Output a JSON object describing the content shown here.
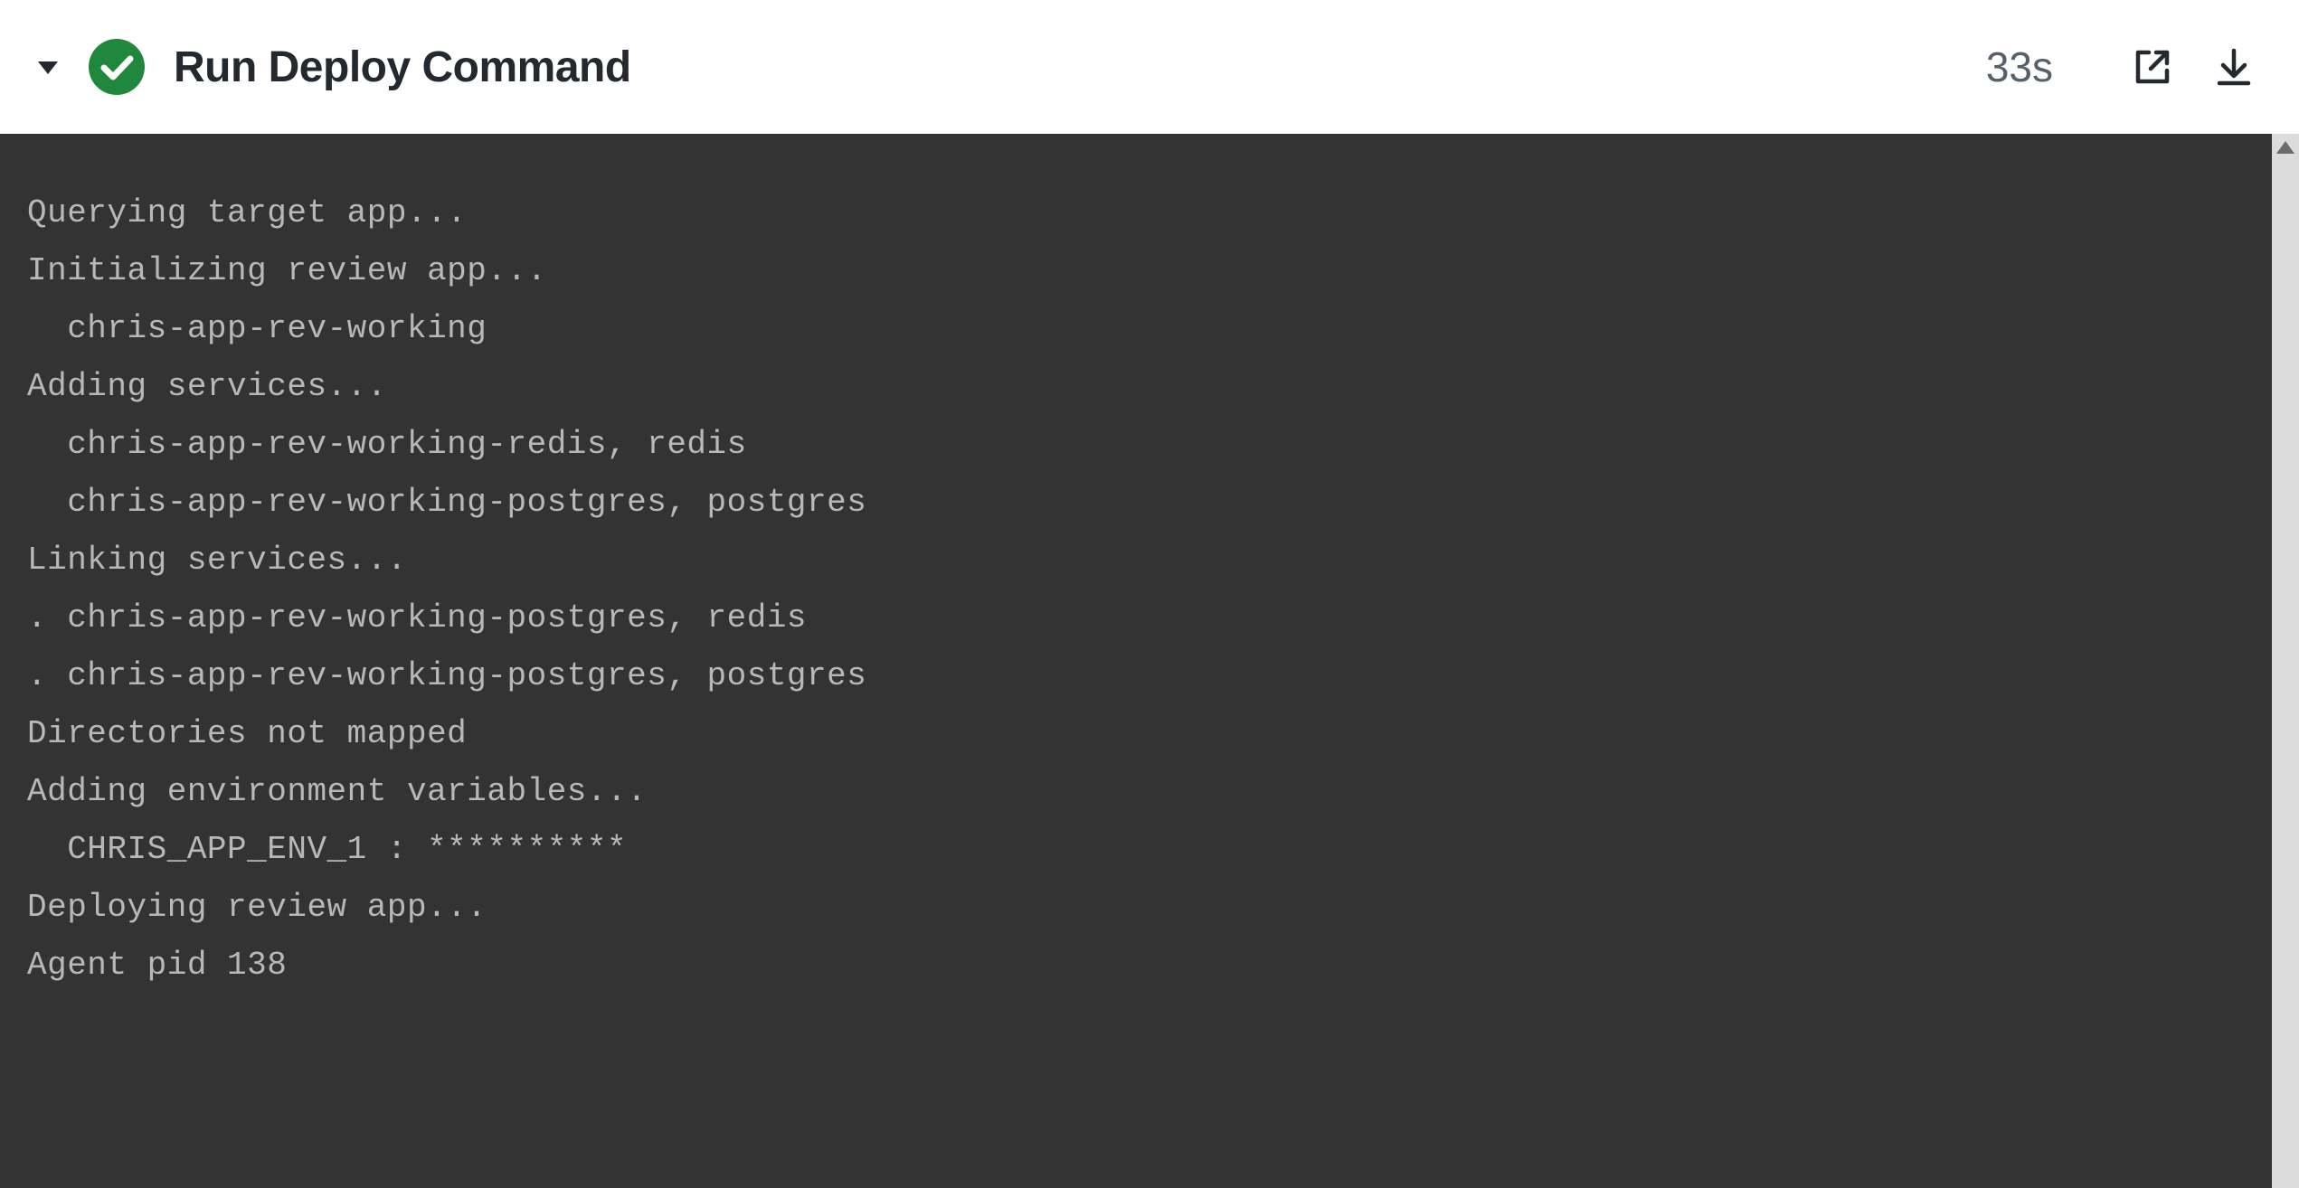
{
  "header": {
    "title": "Run Deploy Command",
    "duration": "33s",
    "status": "success",
    "status_color": "#1f883d",
    "icons": {
      "collapse": "caret-down-icon",
      "status": "check-circle-icon",
      "open_external": "external-link-icon",
      "download": "download-icon"
    }
  },
  "log": {
    "lines": [
      "",
      "Querying target app...",
      "Initializing review app...",
      "  chris-app-rev-working",
      "Adding services...",
      "  chris-app-rev-working-redis, redis",
      "  chris-app-rev-working-postgres, postgres",
      "Linking services...",
      ". chris-app-rev-working-postgres, redis",
      ". chris-app-rev-working-postgres, postgres",
      "Directories not mapped",
      "Adding environment variables...",
      "  CHRIS_APP_ENV_1 : **********",
      "",
      "",
      "Deploying review app...",
      "",
      "Agent pid 138"
    ]
  }
}
